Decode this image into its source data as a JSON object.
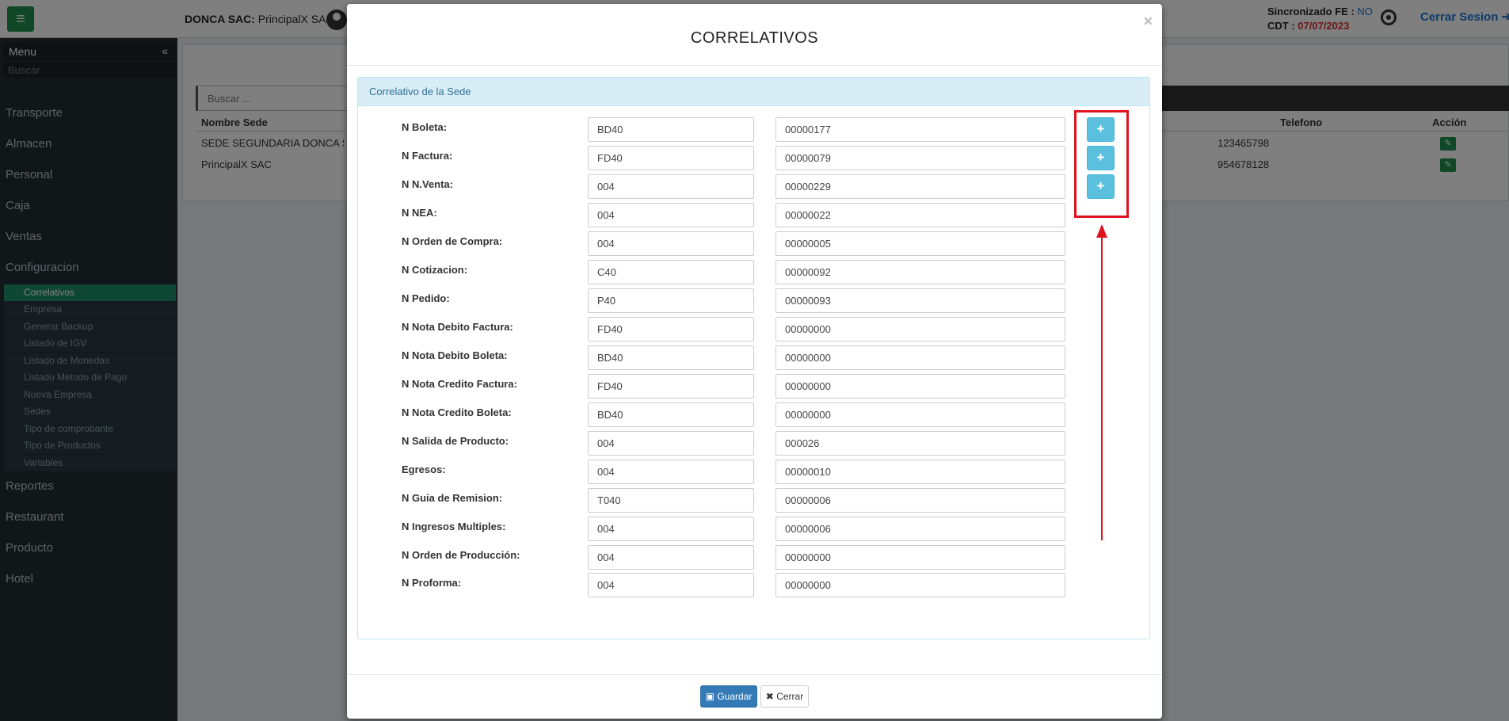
{
  "topbar": {
    "company_bold": "DONCA SAC:",
    "company_rest": " PrincipalX SAC |",
    "sync_label": "Sincronizado FE :",
    "sync_value": "NO",
    "cdt_label": "CDT :",
    "cdt_value": "07/07/2023",
    "logout": "Cerrar Sesion"
  },
  "sidebar": {
    "title": "Menu",
    "collapse": "«",
    "search_placeholder": "Buscar",
    "items": [
      "Transporte",
      "Almacen",
      "Personal",
      "Caja",
      "Ventas",
      "Configuracion"
    ],
    "sub_items": [
      "Correlativos",
      "Empresa",
      "Generar Backup",
      "Listado de IGV",
      "Listado de Monedas",
      "Listado Metodo de Pago",
      "Nueva Empresa",
      "Sedes",
      "Tipo de comprobante",
      "Tipo de Productos",
      "Variables"
    ],
    "items_after": [
      "Reportes",
      "Restaurant",
      "Producto",
      "Hotel"
    ]
  },
  "background": {
    "search_placeholder": "Buscar ...",
    "columns": [
      "Nombre Sede",
      "Telefono",
      "Acción"
    ],
    "rows": [
      {
        "nombre": "SEDE SEGUNDARIA DONCA SAC",
        "telefono": "123465798"
      },
      {
        "nombre": "PrincipalX SAC",
        "telefono": "954678128"
      }
    ]
  },
  "modal": {
    "title": "CORRELATIVOS",
    "close": "×",
    "panel_title": "Correlativo de la Sede",
    "rows": [
      {
        "label": "N Boleta:",
        "serie": "BD40",
        "numero": "00000177"
      },
      {
        "label": "N Factura:",
        "serie": "FD40",
        "numero": "00000079"
      },
      {
        "label": "N N.Venta:",
        "serie": "004",
        "numero": "00000229"
      },
      {
        "label": "N NEA:",
        "serie": "004",
        "numero": "00000022"
      },
      {
        "label": "N Orden de Compra:",
        "serie": "004",
        "numero": "00000005"
      },
      {
        "label": "N Cotizacion:",
        "serie": "C40",
        "numero": "00000092"
      },
      {
        "label": "N Pedido:",
        "serie": "P40",
        "numero": "00000093"
      },
      {
        "label": "N Nota Debito Factura:",
        "serie": "FD40",
        "numero": "00000000"
      },
      {
        "label": "N Nota Debito Boleta:",
        "serie": "BD40",
        "numero": "00000000"
      },
      {
        "label": "N Nota Credito Factura:",
        "serie": "FD40",
        "numero": "00000000"
      },
      {
        "label": "N Nota Credito Boleta:",
        "serie": "BD40",
        "numero": "00000000"
      },
      {
        "label": "N Salida de Producto:",
        "serie": "004",
        "numero": "000026"
      },
      {
        "label": "Egresos:",
        "serie": "004",
        "numero": "00000010"
      },
      {
        "label": "N Guia de Remision:",
        "serie": "T040",
        "numero": "00000006"
      },
      {
        "label": "N Ingresos Multiples:",
        "serie": "004",
        "numero": "00000006"
      },
      {
        "label": "N Orden de Producción:",
        "serie": "004",
        "numero": "00000000"
      },
      {
        "label": "N Proforma:",
        "serie": "004",
        "numero": "00000000"
      }
    ],
    "plus_symbol": "+",
    "save_label": "Guardar",
    "close_label": "Cerrar"
  },
  "colors": {
    "accent_green": "#1e8f4f",
    "info_blue": "#5bc0de",
    "primary_blue": "#337ab7",
    "highlight_red": "#e0141f"
  }
}
